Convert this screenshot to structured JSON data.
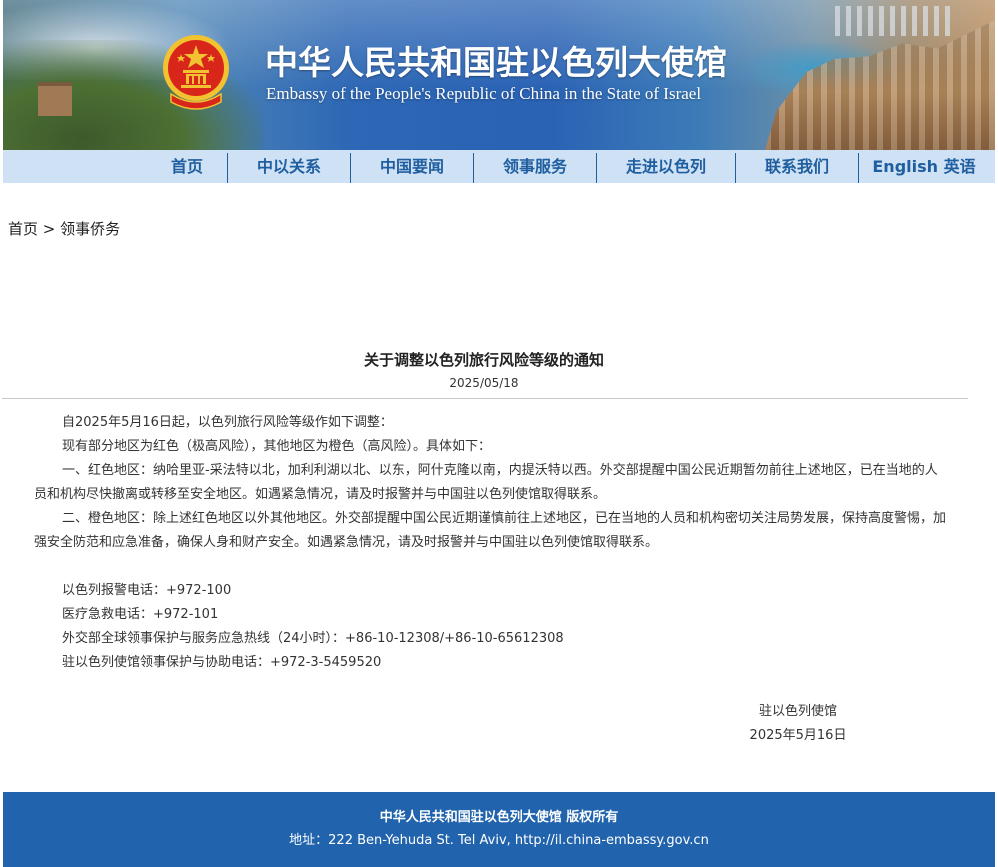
{
  "header": {
    "title_cn": "中华人民共和国驻以色列大使馆",
    "title_en": "Embassy of the People's Republic of China in the State of Israel"
  },
  "nav": {
    "items": [
      {
        "label": "首页"
      },
      {
        "label": "中以关系"
      },
      {
        "label": "中国要闻"
      },
      {
        "label": "领事服务"
      },
      {
        "label": "走进以色列"
      },
      {
        "label": "联系我们"
      },
      {
        "label": "English 英语"
      }
    ]
  },
  "breadcrumb": {
    "home": "首页",
    "separator": " > ",
    "current": "领事侨务"
  },
  "article": {
    "title": "关于调整以色列旅行风险等级的通知",
    "date": "2025/05/18",
    "paragraphs": [
      "自2025年5月16日起，以色列旅行风险等级作如下调整：",
      "现有部分地区为红色（极高风险），其他地区为橙色（高风险）。具体如下：",
      "一、红色地区：纳哈里亚-采法特以北，加利利湖以北、以东，阿什克隆以南，内提沃特以西。外交部提醒中国公民近期暂勿前往上述地区，已在当地的人员和机构尽快撤离或转移至安全地区。如遇紧急情况，请及时报警并与中国驻以色列使馆取得联系。",
      "二、橙色地区：除上述红色地区以外其他地区。外交部提醒中国公民近期谨慎前往上述地区，已在当地的人员和机构密切关注局势发展，保持高度警惕，加强安全防范和应急准备，确保人身和财产安全。如遇紧急情况，请及时报警并与中国驻以色列使馆取得联系。"
    ],
    "contacts": [
      "以色列报警电话：+972-100",
      "医疗急救电话：+972-101",
      "外交部全球领事保护与服务应急热线（24小时）：+86-10-12308/+86-10-65612308",
      "驻以色列使馆领事保护与协助电话：+972-3-5459520"
    ],
    "signature": "驻以色列使馆",
    "signature_date": "2025年5月16日"
  },
  "footer": {
    "line1": "中华人民共和国驻以色列大使馆 版权所有",
    "line2": "地址：222 Ben-Yehuda St. Tel Aviv, http://il.china-embassy.gov.cn"
  },
  "colors": {
    "nav_bg": "#cfe1f4",
    "nav_text": "#1f5fa0",
    "footer_bg": "#2164ad",
    "emblem_red": "#d8261b",
    "emblem_gold": "#f2c230"
  },
  "icons": {
    "emblem": "national-emblem-icon"
  }
}
